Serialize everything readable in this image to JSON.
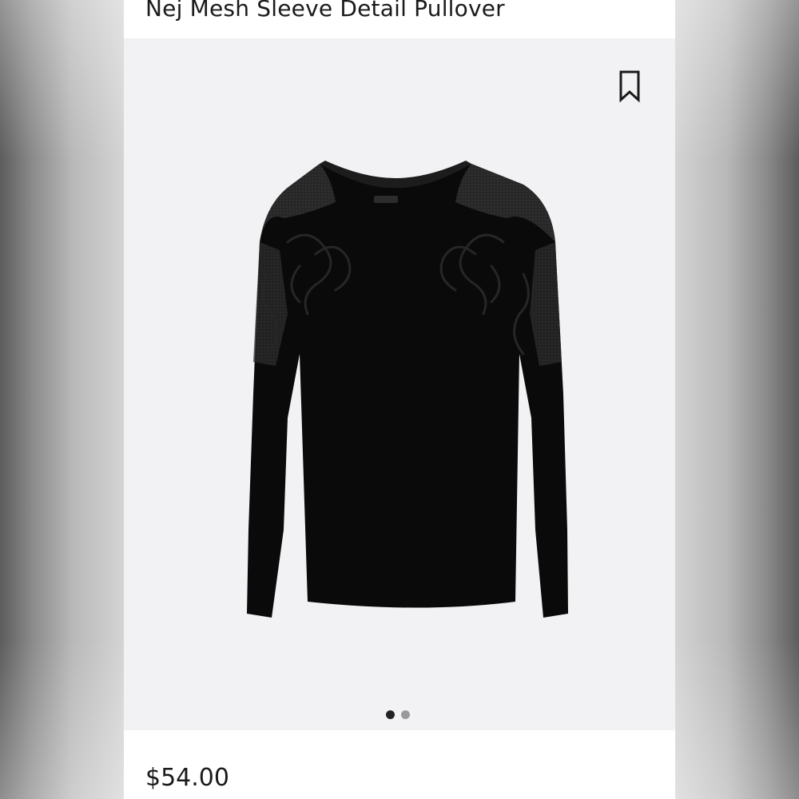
{
  "product": {
    "title": "Nej Mesh Sleeve Detail Pullover",
    "price": "$54.00",
    "image_alt": "Black knit pullover with mesh shoulder panels and embroidered appliqué detail"
  },
  "icons": {
    "bookmark": "bookmark-icon"
  },
  "carousel": {
    "total": 2,
    "active_index": 0
  },
  "colors": {
    "panel": "#ffffff",
    "image_background": "#f2f2f4",
    "text": "#1a1a1a",
    "dot_active": "#222222",
    "dot_inactive": "#9a9a9a",
    "garment": "#0a0a0a"
  }
}
